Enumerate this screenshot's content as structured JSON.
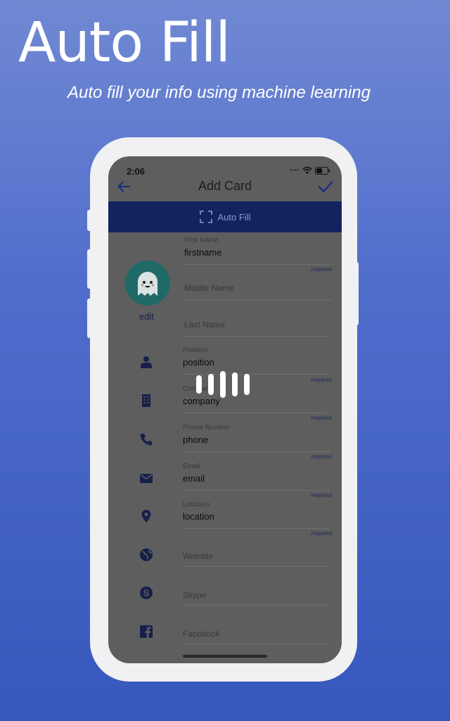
{
  "hero": {
    "title": "Auto Fill",
    "subtitle": "Auto fill your info using machine learning"
  },
  "status_bar": {
    "time": "2:06"
  },
  "navbar": {
    "title": "Add Card"
  },
  "autofill_bar": {
    "label": "Auto Fill"
  },
  "avatar": {
    "edit_label": "edit"
  },
  "fields": {
    "first_name": {
      "label": "First Name",
      "value": "firstname",
      "required": "required"
    },
    "middle_name": {
      "placeholder": "Middle Name"
    },
    "last_name": {
      "placeholder": "Last Name"
    },
    "position": {
      "label": "Position",
      "value": "position",
      "required": "required"
    },
    "company": {
      "label": "Company",
      "value": "company",
      "required": "required"
    },
    "phone": {
      "label": "Phone Number",
      "value": "phone",
      "required": "required"
    },
    "email": {
      "label": "Email",
      "value": "email",
      "required": "required"
    },
    "location": {
      "label": "Location",
      "value": "location",
      "required": "required"
    },
    "website": {
      "placeholder": "Website"
    },
    "skype": {
      "placeholder": "Skype"
    },
    "facebook": {
      "placeholder": "Facebook"
    }
  },
  "colors": {
    "background_top": "#7189d3",
    "background_bottom": "#3657bc",
    "autofill_bar": "#13235e",
    "icon_color": "#17204a",
    "avatar": "#1f6a66"
  }
}
